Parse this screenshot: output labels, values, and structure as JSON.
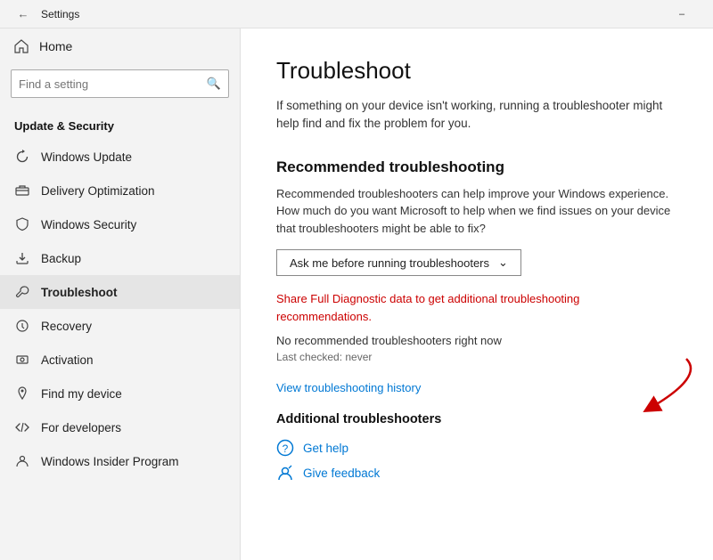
{
  "titleBar": {
    "title": "Settings",
    "minimizeLabel": "–"
  },
  "sidebar": {
    "homeLabel": "Home",
    "searchPlaceholder": "Find a setting",
    "sectionLabel": "Update & Security",
    "items": [
      {
        "id": "windows-update",
        "label": "Windows Update",
        "icon": "refresh"
      },
      {
        "id": "delivery-optimization",
        "label": "Delivery Optimization",
        "icon": "delivery"
      },
      {
        "id": "windows-security",
        "label": "Windows Security",
        "icon": "shield"
      },
      {
        "id": "backup",
        "label": "Backup",
        "icon": "backup"
      },
      {
        "id": "troubleshoot",
        "label": "Troubleshoot",
        "icon": "wrench",
        "active": true
      },
      {
        "id": "recovery",
        "label": "Recovery",
        "icon": "recovery"
      },
      {
        "id": "activation",
        "label": "Activation",
        "icon": "activation"
      },
      {
        "id": "find-my-device",
        "label": "Find my device",
        "icon": "location"
      },
      {
        "id": "for-developers",
        "label": "For developers",
        "icon": "developer"
      },
      {
        "id": "windows-insider",
        "label": "Windows Insider Program",
        "icon": "insider"
      }
    ]
  },
  "content": {
    "pageTitle": "Troubleshoot",
    "introText": "If something on your device isn't working, running a troubleshooter might help find and fix the problem for you.",
    "recommendedSection": {
      "title": "Recommended troubleshooting",
      "desc": "Recommended troubleshooters can help improve your Windows experience. How much do you want Microsoft to help when we find issues on your device that troubleshooters might be able to fix?",
      "dropdownLabel": "Ask me before running troubleshooters",
      "linkRedText": "Share Full Diagnostic data to get additional troubleshooting recommendations.",
      "statusText": "No recommended troubleshooters right now",
      "lastChecked": "Last checked: never"
    },
    "historyLink": "View troubleshooting history",
    "additionalSection": {
      "title": "Additional troubleshooters"
    },
    "getHelp": "Get help",
    "giveFeedback": "Give feedback"
  }
}
